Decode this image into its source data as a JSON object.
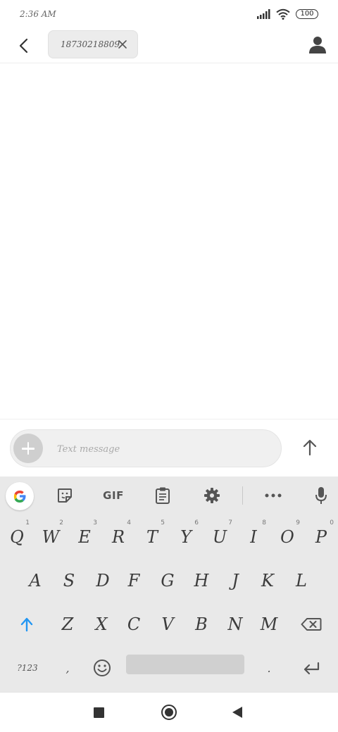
{
  "status_bar": {
    "time": "2:36 AM",
    "battery": "100",
    "icons": [
      "signal-icon",
      "wifi-icon",
      "battery-icon"
    ]
  },
  "header": {
    "recipient_chip": "18730218809",
    "icons": [
      "back-arrow-icon",
      "close-icon",
      "contact-icon"
    ]
  },
  "compose": {
    "placeholder": "Text message",
    "value": "",
    "icons": [
      "add-icon",
      "send-arrow-icon"
    ]
  },
  "keyboard": {
    "toolbar": {
      "gif_label": "GIF",
      "icons": [
        "google-icon",
        "sticker-icon",
        "clipboard-icon",
        "settings-gear-icon",
        "more-icon",
        "microphone-icon"
      ]
    },
    "row1": [
      {
        "label": "Q",
        "hint": "1"
      },
      {
        "label": "W",
        "hint": "2"
      },
      {
        "label": "E",
        "hint": "3"
      },
      {
        "label": "R",
        "hint": "4"
      },
      {
        "label": "T",
        "hint": "5"
      },
      {
        "label": "Y",
        "hint": "6"
      },
      {
        "label": "U",
        "hint": "7"
      },
      {
        "label": "I",
        "hint": "8"
      },
      {
        "label": "O",
        "hint": "9"
      },
      {
        "label": "P",
        "hint": "0"
      }
    ],
    "row2": [
      "A",
      "S",
      "D",
      "F",
      "G",
      "H",
      "J",
      "K",
      "L"
    ],
    "row3": [
      "Z",
      "X",
      "C",
      "V",
      "B",
      "N",
      "M"
    ],
    "row4": {
      "symbols_label": "?123",
      "comma": ",",
      "period": "."
    },
    "accent_color": "#2196f3"
  },
  "nav_bar": {
    "icons": [
      "recents-square-icon",
      "home-circle-icon",
      "back-triangle-icon"
    ]
  }
}
